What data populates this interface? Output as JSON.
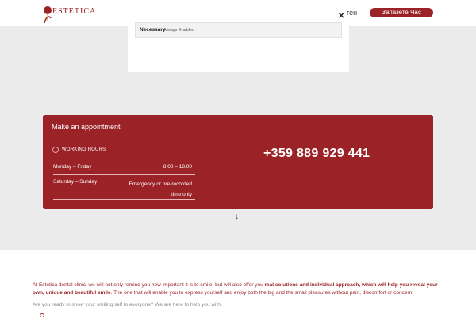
{
  "header": {
    "logo_text": "ESTETICA",
    "lang": "ген",
    "book_button": "Запазете Час"
  },
  "cookie": {
    "category": "Necessary",
    "status": "Always Enabled",
    "close_label": "✕"
  },
  "appointment": {
    "title": "Make an appointment",
    "working_hours_label": "WORKING HOURS",
    "rows": [
      {
        "day": "Monday – Friday",
        "time": "8.00 – 18.00"
      },
      {
        "day": "Saturday – Sunday",
        "time": "Emergency or pre-recorded time only"
      }
    ],
    "phone": "+359 889 929 441"
  },
  "scroll_arrow": "↓",
  "content": {
    "p1_a": "At Estetica dental clinic, we will not only remind you how important it is to smile, but will also offer you ",
    "p1_b": "real solutions and individual approach, which will help you reveal your own, unique and beautiful smile",
    "p1_c": ". The one that will enable you to express yourself and enjoy both the big and the small pleasures without pain, discomfort or concern.",
    "p2": "Are you ready to show your smiling self to everyone? We are here to help you with:"
  },
  "colors": {
    "brand": "#9b2226",
    "overlay": "#ebebeb"
  }
}
